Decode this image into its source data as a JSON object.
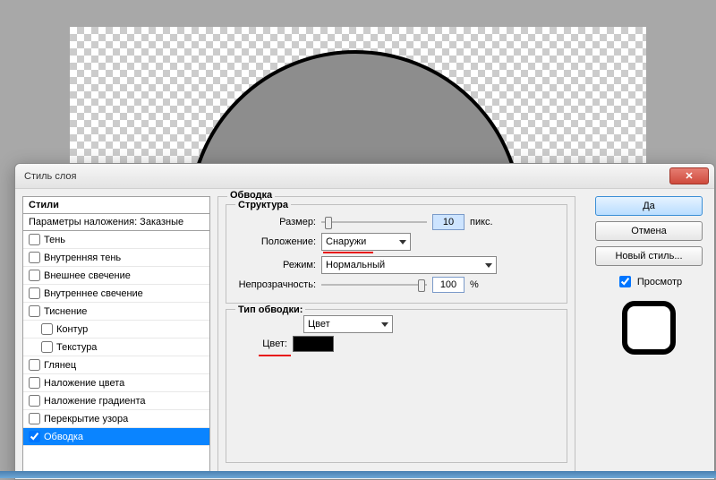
{
  "dialog": {
    "title": "Стиль слоя",
    "close_glyph": "✕"
  },
  "styles_panel": {
    "header": "Стили",
    "blend_options": "Параметры наложения: Заказные",
    "items": [
      {
        "label": "Тень",
        "checked": false,
        "selected": false
      },
      {
        "label": "Внутренняя тень",
        "checked": false,
        "selected": false
      },
      {
        "label": "Внешнее свечение",
        "checked": false,
        "selected": false
      },
      {
        "label": "Внутреннее свечение",
        "checked": false,
        "selected": false
      },
      {
        "label": "Тиснение",
        "checked": false,
        "selected": false
      },
      {
        "label": "Контур",
        "checked": false,
        "selected": false,
        "indent": true
      },
      {
        "label": "Текстура",
        "checked": false,
        "selected": false,
        "indent": true
      },
      {
        "label": "Глянец",
        "checked": false,
        "selected": false
      },
      {
        "label": "Наложение цвета",
        "checked": false,
        "selected": false
      },
      {
        "label": "Наложение градиента",
        "checked": false,
        "selected": false
      },
      {
        "label": "Перекрытие узора",
        "checked": false,
        "selected": false
      },
      {
        "label": "Обводка",
        "checked": true,
        "selected": true
      }
    ]
  },
  "stroke_panel": {
    "section_title": "Обводка",
    "structure_title": "Структура",
    "size_label": "Размер:",
    "size_value": "10",
    "size_unit": "пикс.",
    "position_label": "Положение:",
    "position_value": "Снаружи",
    "mode_label": "Режим:",
    "mode_value": "Нормальный",
    "opacity_label": "Непрозрачность:",
    "opacity_value": "100",
    "opacity_unit": "%",
    "filltype_title": "Тип обводки:",
    "filltype_value": "Цвет",
    "color_label": "Цвет:",
    "color_value": "#000000"
  },
  "buttons": {
    "ok": "Да",
    "cancel": "Отмена",
    "new_style": "Новый стиль...",
    "preview": "Просмотр"
  }
}
